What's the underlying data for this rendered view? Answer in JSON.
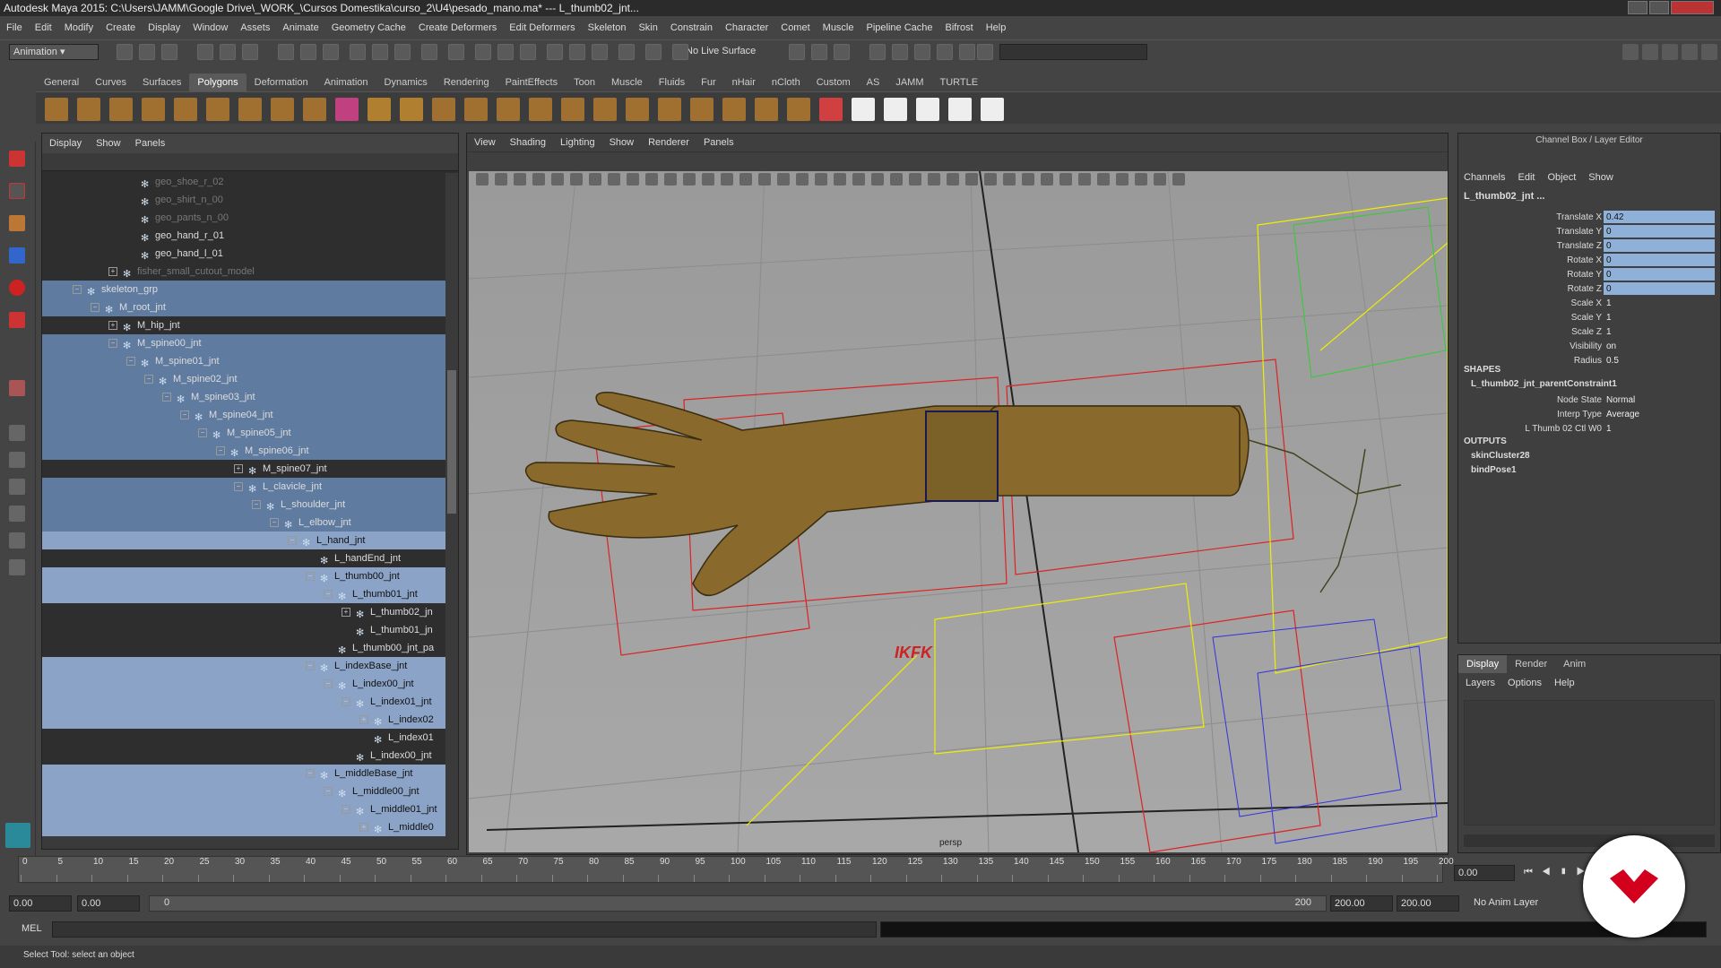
{
  "title": "Autodesk Maya 2015: C:\\Users\\JAMM\\Google Drive\\_WORK_\\Cursos Domestika\\curso_2\\U4\\pesado_mano.ma*  ---  L_thumb02_jnt...",
  "menubar": [
    "File",
    "Edit",
    "Modify",
    "Create",
    "Display",
    "Window",
    "Assets",
    "Animate",
    "Geometry Cache",
    "Create Deformers",
    "Edit Deformers",
    "Skeleton",
    "Skin",
    "Constrain",
    "Character",
    "Comet",
    "Muscle",
    "Pipeline Cache",
    "Bifrost",
    "Help"
  ],
  "status": {
    "mode": "Animation",
    "live_surface": "No Live Surface"
  },
  "shelf_tabs": [
    "General",
    "Curves",
    "Surfaces",
    "Polygons",
    "Deformation",
    "Animation",
    "Dynamics",
    "Rendering",
    "PaintEffects",
    "Toon",
    "Muscle",
    "Fluids",
    "Fur",
    "nHair",
    "nCloth",
    "Custom",
    "AS",
    "JAMM",
    "TURTLE"
  ],
  "outliner": {
    "menu": [
      "Display",
      "Show",
      "Panels"
    ],
    "rows": [
      {
        "name": "geo_shoe_r_02",
        "indent": 5,
        "state": "dim",
        "exp": ""
      },
      {
        "name": "geo_shirt_n_00",
        "indent": 5,
        "state": "dim",
        "exp": ""
      },
      {
        "name": "geo_pants_n_00",
        "indent": 5,
        "state": "dim",
        "exp": ""
      },
      {
        "name": "geo_hand_r_01",
        "indent": 5,
        "state": "",
        "exp": ""
      },
      {
        "name": "geo_hand_l_01",
        "indent": 5,
        "state": "",
        "exp": ""
      },
      {
        "name": "fisher_small_cutout_model",
        "indent": 4,
        "state": "dim",
        "exp": "+"
      },
      {
        "name": "skeleton_grp",
        "indent": 2,
        "state": "sel",
        "exp": "-"
      },
      {
        "name": "M_root_jnt",
        "indent": 3,
        "state": "sel",
        "exp": "-"
      },
      {
        "name": "M_hip_jnt",
        "indent": 4,
        "state": "",
        "exp": "+"
      },
      {
        "name": "M_spine00_jnt",
        "indent": 4,
        "state": "sel",
        "exp": "-"
      },
      {
        "name": "M_spine01_jnt",
        "indent": 5,
        "state": "sel",
        "exp": "-"
      },
      {
        "name": "M_spine02_jnt",
        "indent": 6,
        "state": "sel",
        "exp": "-"
      },
      {
        "name": "M_spine03_jnt",
        "indent": 7,
        "state": "sel",
        "exp": "-"
      },
      {
        "name": "M_spine04_jnt",
        "indent": 8,
        "state": "sel",
        "exp": "-"
      },
      {
        "name": "M_spine05_jnt",
        "indent": 9,
        "state": "sel",
        "exp": "-"
      },
      {
        "name": "M_spine06_jnt",
        "indent": 10,
        "state": "sel",
        "exp": "-"
      },
      {
        "name": "M_spine07_jnt",
        "indent": 11,
        "state": "",
        "exp": "+"
      },
      {
        "name": "L_clavicle_jnt",
        "indent": 11,
        "state": "sel",
        "exp": "-"
      },
      {
        "name": "L_shoulder_jnt",
        "indent": 12,
        "state": "sel",
        "exp": "-"
      },
      {
        "name": "L_elbow_jnt",
        "indent": 13,
        "state": "sel",
        "exp": "-"
      },
      {
        "name": "L_hand_jnt",
        "indent": 14,
        "state": "sel2",
        "exp": "-"
      },
      {
        "name": "L_handEnd_jnt",
        "indent": 15,
        "state": "",
        "exp": ""
      },
      {
        "name": "L_thumb00_jnt",
        "indent": 15,
        "state": "sel2",
        "exp": "-"
      },
      {
        "name": "L_thumb01_jnt",
        "indent": 16,
        "state": "sel2",
        "exp": "-"
      },
      {
        "name": "L_thumb02_jn",
        "indent": 17,
        "state": "",
        "exp": "+"
      },
      {
        "name": "L_thumb01_jn",
        "indent": 17,
        "state": "",
        "exp": ""
      },
      {
        "name": "L_thumb00_jnt_pa",
        "indent": 16,
        "state": "",
        "exp": ""
      },
      {
        "name": "L_indexBase_jnt",
        "indent": 15,
        "state": "sel2",
        "exp": "-"
      },
      {
        "name": "L_index00_jnt",
        "indent": 16,
        "state": "sel2",
        "exp": "-"
      },
      {
        "name": "L_index01_jnt",
        "indent": 17,
        "state": "sel2",
        "exp": "-"
      },
      {
        "name": "L_index02",
        "indent": 18,
        "state": "sel2",
        "exp": "+"
      },
      {
        "name": "L_index01",
        "indent": 18,
        "state": "",
        "exp": ""
      },
      {
        "name": "L_index00_jnt",
        "indent": 17,
        "state": "",
        "exp": ""
      },
      {
        "name": "L_middleBase_jnt",
        "indent": 15,
        "state": "sel2",
        "exp": "-"
      },
      {
        "name": "L_middle00_jnt",
        "indent": 16,
        "state": "sel2",
        "exp": "-"
      },
      {
        "name": "L_middle01_jnt",
        "indent": 17,
        "state": "sel2",
        "exp": "-"
      },
      {
        "name": "L_middle0",
        "indent": 18,
        "state": "sel2",
        "exp": "+"
      }
    ]
  },
  "viewport": {
    "menu": [
      "View",
      "Shading",
      "Lighting",
      "Show",
      "Renderer",
      "Panels"
    ],
    "camera": "persp",
    "ikfk": "IKFK"
  },
  "channel_box": {
    "title": "Channel Box / Layer Editor",
    "menu": [
      "Channels",
      "Edit",
      "Object",
      "Show"
    ],
    "object": "L_thumb02_jnt ...",
    "attrs": [
      {
        "n": "Translate X",
        "v": "0.42",
        "hl": true
      },
      {
        "n": "Translate Y",
        "v": "0",
        "hl": true
      },
      {
        "n": "Translate Z",
        "v": "0",
        "hl": true
      },
      {
        "n": "Rotate X",
        "v": "0",
        "hl": true
      },
      {
        "n": "Rotate Y",
        "v": "0",
        "hl": true
      },
      {
        "n": "Rotate Z",
        "v": "0",
        "hl": true
      },
      {
        "n": "Scale X",
        "v": "1",
        "hl": false
      },
      {
        "n": "Scale Y",
        "v": "1",
        "hl": false
      },
      {
        "n": "Scale Z",
        "v": "1",
        "hl": false
      },
      {
        "n": "Visibility",
        "v": "on",
        "hl": false
      },
      {
        "n": "Radius",
        "v": "0.5",
        "hl": false
      }
    ],
    "shapes_label": "SHAPES",
    "shape_name": "L_thumb02_jnt_parentConstraint1",
    "shape_attrs": [
      {
        "n": "Node State",
        "v": "Normal"
      },
      {
        "n": "Interp Type",
        "v": "Average"
      },
      {
        "n": "L Thumb 02 Ctl W0",
        "v": "1"
      }
    ],
    "outputs_label": "OUTPUTS",
    "outputs": [
      "skinCluster28",
      "bindPose1"
    ]
  },
  "layer_editor": {
    "tabs": [
      "Display",
      "Render",
      "Anim"
    ],
    "menu": [
      "Layers",
      "Options",
      "Help"
    ]
  },
  "time": {
    "ticks": [
      "0",
      "5",
      "10",
      "15",
      "20",
      "25",
      "30",
      "35",
      "40",
      "45",
      "50",
      "55",
      "60",
      "65",
      "70",
      "75",
      "80",
      "85",
      "90",
      "95",
      "100",
      "105",
      "110",
      "115",
      "120",
      "125",
      "130",
      "135",
      "140",
      "145",
      "150",
      "155",
      "160",
      "165",
      "170",
      "175",
      "180",
      "185",
      "190",
      "195",
      "200"
    ],
    "current": "0.00",
    "start": "0.00",
    "start2": "0.00",
    "range_start": "0",
    "range_end": "200",
    "end": "200.00",
    "end2": "200.00",
    "anim_layer": "No Anim Layer"
  },
  "mel": {
    "label": "MEL"
  },
  "help": "Select Tool: select an object"
}
